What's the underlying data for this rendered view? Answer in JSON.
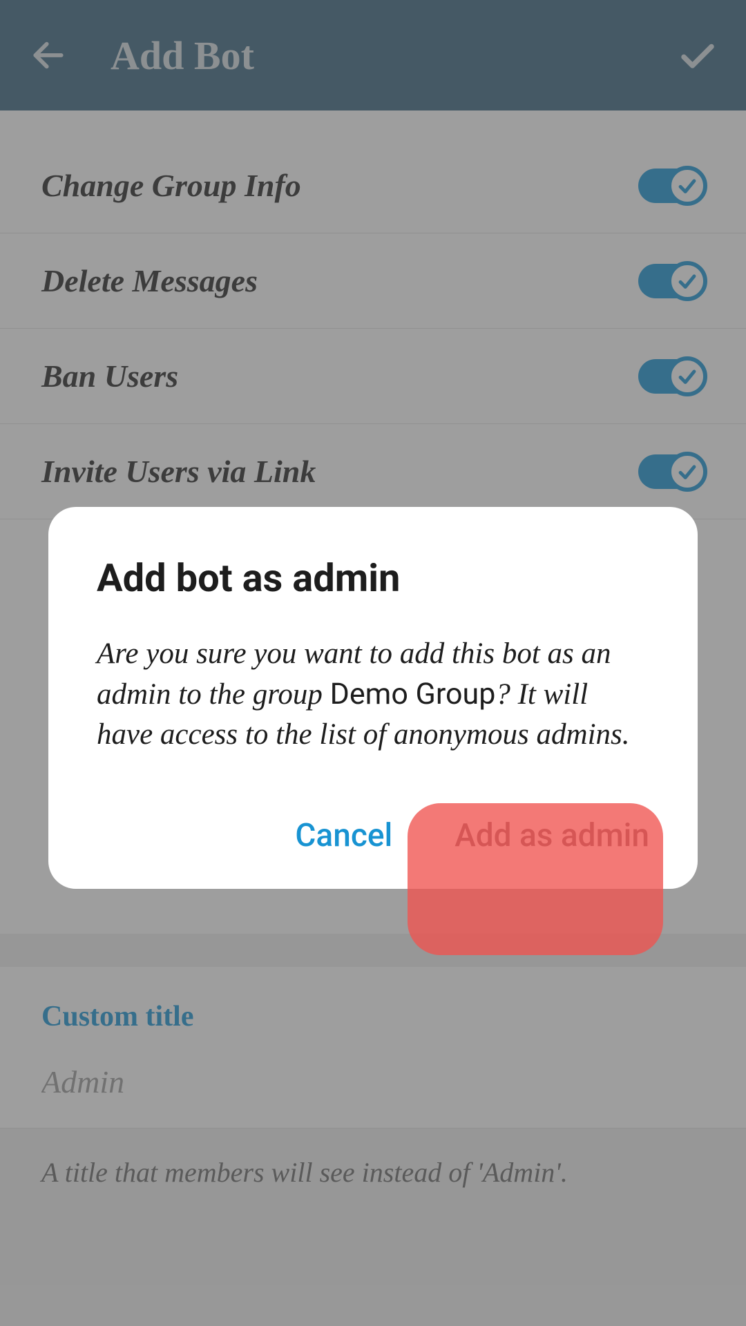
{
  "header": {
    "title": "Add Bot"
  },
  "permissions": [
    {
      "label": "Change Group Info",
      "on": true
    },
    {
      "label": "Delete Messages",
      "on": true
    },
    {
      "label": "Ban Users",
      "on": true
    },
    {
      "label": "Invite Users via Link",
      "on": true
    }
  ],
  "custom_title": {
    "label": "Custom title",
    "placeholder": "Admin",
    "hint": "A title that members will see instead of 'Admin'."
  },
  "dialog": {
    "title": "Add bot as admin",
    "body_pre": "Are you sure you want to add this bot as an admin to the group ",
    "group_name": "Demo Group",
    "body_post": "? It will have access to the list of anonymous admins.",
    "cancel": "Cancel",
    "confirm": "Add as admin"
  }
}
